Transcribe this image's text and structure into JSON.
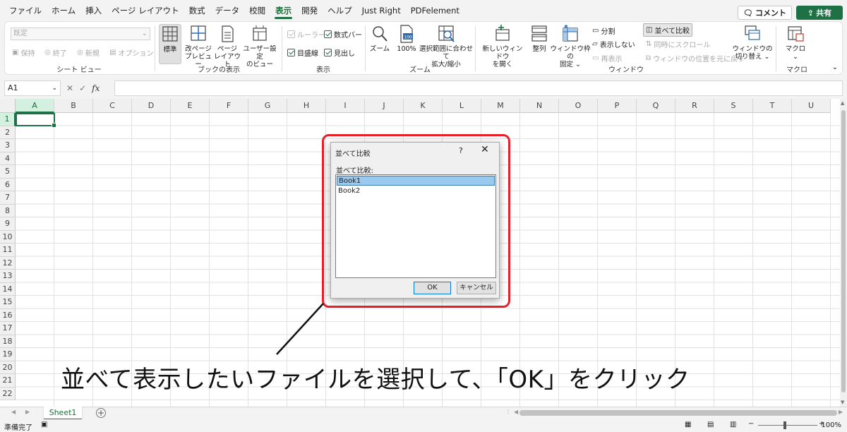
{
  "menu": {
    "tabs": [
      "ファイル",
      "ホーム",
      "挿入",
      "ページ レイアウト",
      "数式",
      "データ",
      "校閲",
      "表示",
      "開発",
      "ヘルプ",
      "Just Right",
      "PDFelement"
    ],
    "active_index": 7,
    "comment_label": "コメント",
    "share_label": "共有"
  },
  "ribbon": {
    "sheet_view": {
      "combo_value": "既定",
      "keep": "保持",
      "exit": "終了",
      "new": "新規",
      "options": "オプション",
      "label": "シート ビュー"
    },
    "workbook_views": {
      "normal": "標準",
      "page_break_1": "改ページ",
      "page_break_2": "プレビュー",
      "page_layout_1": "ページ",
      "page_layout_2": "レイアウト",
      "custom_1": "ユーザー設定",
      "custom_2": "のビュー",
      "label": "ブックの表示"
    },
    "show": {
      "ruler": "ルーラー",
      "formula_bar": "数式バー",
      "gridlines": "目盛線",
      "headings": "見出し",
      "label": "表示"
    },
    "zoom": {
      "zoom": "ズーム",
      "p100": "100%",
      "sel_1": "選択範囲に合わせて",
      "sel_2": "拡大/縮小",
      "label": "ズーム",
      "icon_text": "100"
    },
    "window": {
      "new_1": "新しいウィンドウ",
      "new_2": "を開く",
      "arrange": "整列",
      "freeze_1": "ウィンドウ枠の",
      "freeze_2": "固定 ⌄",
      "split": "分割",
      "hide": "表示しない",
      "unhide": "再表示",
      "side_by_side": "並べて比較",
      "sync_scroll": "同時にスクロール",
      "reset_pos": "ウィンドウの位置を元に戻す",
      "switch_1": "ウィンドウの",
      "switch_2": "切り替え ⌄",
      "label": "ウィンドウ"
    },
    "macro": {
      "macro_1": "マクロ",
      "macro_2": "⌄",
      "label": "マクロ"
    }
  },
  "formula_bar": {
    "name_box": "A1",
    "fx": "fx",
    "value": ""
  },
  "sheet": {
    "columns": [
      "A",
      "B",
      "C",
      "D",
      "E",
      "F",
      "G",
      "H",
      "I",
      "J",
      "K",
      "L",
      "M",
      "N",
      "O",
      "P",
      "Q",
      "R",
      "S",
      "T",
      "U"
    ],
    "rows": [
      "1",
      "2",
      "3",
      "4",
      "5",
      "6",
      "7",
      "8",
      "9",
      "10",
      "11",
      "12",
      "13",
      "14",
      "15",
      "16",
      "17",
      "18",
      "19",
      "20",
      "21",
      "22"
    ],
    "selected_cell": "A1"
  },
  "dialog": {
    "title": "並べて比較",
    "help": "?",
    "close": "✕",
    "list_label": "並べて比較:",
    "items": [
      "Book1",
      "Book2"
    ],
    "selected_index": 0,
    "ok": "OK",
    "cancel": "キャンセル"
  },
  "annotation": {
    "caption": "並べて表示したいファイルを選択して、「OK」をクリック",
    "color": "#e8202a"
  },
  "tabs": {
    "sheet": "Sheet1",
    "add": "+"
  },
  "status": {
    "ready": "準備完了",
    "zoom": "100%"
  },
  "colors": {
    "accent": "#1e7145"
  }
}
